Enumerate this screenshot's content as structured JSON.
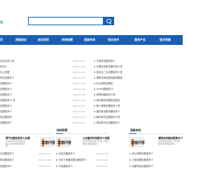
{
  "header": {
    "logo_text": "法",
    "search": {
      "placeholder": ""
    }
  },
  "nav": {
    "items": [
      "首页",
      "西部创业",
      "创业项目",
      "扶持政策",
      "西部市场",
      "创业合作",
      "服务产业",
      "经济发展"
    ]
  },
  "left_list": [
    "交互技术公司",
    "机多少",
    "办公加盟",
    "项目加盟多少",
    "加盟费多少",
    "加盟费多少",
    "加盟费多少",
    "加盟费多少 钱",
    "加盟费多少",
    "加盟费多少",
    "的加盟费多",
    "加盟费多少"
  ],
  "middle_dates": [
    "2020-10-16",
    "2020-10-16",
    "2020-10-16",
    "2020-10-16",
    "2020-10-16",
    "2020-10-16",
    "2020-10-16",
    "2020-10-16",
    "2020-10-16",
    "2020-10-16",
    "2020-10-16",
    "2020-10-16"
  ],
  "right_list": [
    "艾美林加盟费多少",
    "无锡实验室加盟的怎么样",
    "渝北区二手加盟费多少钱",
    "湖阳互网加盟电器加盟费",
    "恋山网购加盟店",
    "hme加盟费多少",
    "绿湾加盟费多少钱",
    "海北路邦加盟型连锁店",
    "美人雅家加盟费多少钱",
    "晨光家加盟电器费多少",
    "福州城市加盟费多少钱",
    "湖北清华来加盟费多少"
  ],
  "sections": [
    {
      "title": "",
      "card_title": "周宁加盟店是怎么加盟",
      "card_desc": "为您解决问题加盟店加盟怎么样条件费用等问题",
      "thumb_text": "加盟问答",
      "items": [
        "位加盟费多少",
        "泰加盟费多少",
        "加盟费多少"
      ],
      "dates": [
        "2020-10-16",
        "2020-10-16",
        "2020-10-16"
      ]
    },
    {
      "title": "扶持政策",
      "card_title": "九龙重庆扶持型多少加盟",
      "card_desc": "如何加盟的店铺 条件多少钱问题等 加盟费用多少",
      "thumb_text": "加盟问答",
      "items": [
        "光谷加盟费多少",
        "五年万电器加盟加盟费多少",
        "平加盟费多少"
      ],
      "dates": [
        "2020-10-16",
        "2020-10-16",
        "2020-10-16"
      ]
    },
    {
      "title": "西部市场",
      "card_title": "潮阳区商铺加盟费多少",
      "card_desc": "潮阳区加盟费多少 加盟费 加盟 条件费用问题",
      "thumb_text": "加盟问答",
      "items": [
        "恋山网购加盟费多少",
        "小松加盟加盟费多少",
        "加盟特色加盟费多少"
      ],
      "dates": [
        "",
        "",
        ""
      ]
    }
  ],
  "colors": {
    "brand_blue": "#1a5fb4",
    "logo_green": "#1b8f3a",
    "accent_orange": "#e87722"
  }
}
